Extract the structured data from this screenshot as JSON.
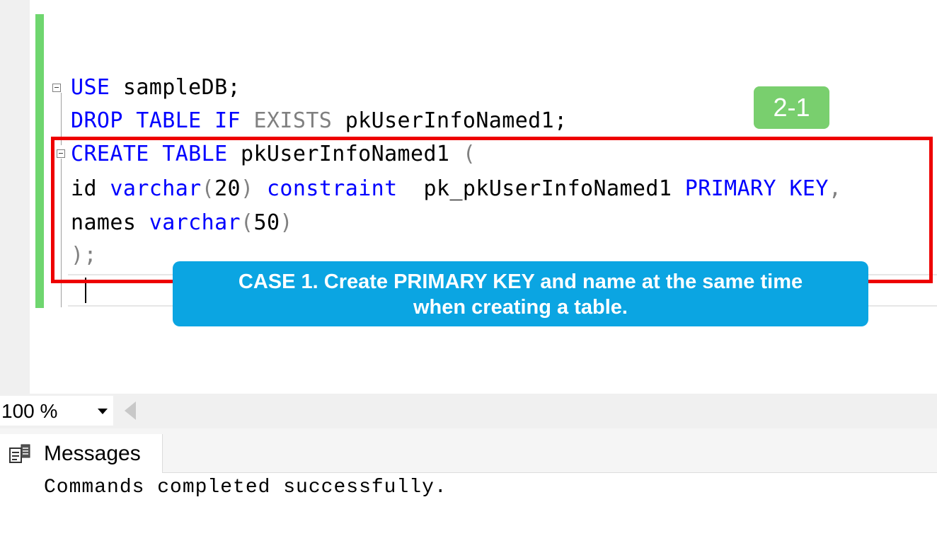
{
  "editor": {
    "code_lines": [
      [
        {
          "text": "USE",
          "cls": "kw"
        },
        {
          "text": " sampleDB;",
          "cls": ""
        }
      ],
      [
        {
          "text": "DROP TABLE IF",
          "cls": "kw"
        },
        {
          "text": " ",
          "cls": ""
        },
        {
          "text": "EXISTS",
          "cls": "kw-gray"
        },
        {
          "text": " pkUserInfoNamed1;",
          "cls": ""
        }
      ],
      [
        {
          "text": "CREATE TABLE",
          "cls": "kw"
        },
        {
          "text": " pkUserInfoNamed1 ",
          "cls": ""
        },
        {
          "text": "(",
          "cls": "kw-gray"
        }
      ],
      [
        {
          "text": "id ",
          "cls": ""
        },
        {
          "text": "varchar",
          "cls": "kw"
        },
        {
          "text": "(",
          "cls": "kw-gray"
        },
        {
          "text": "20",
          "cls": ""
        },
        {
          "text": ")",
          "cls": "kw-gray"
        },
        {
          "text": " ",
          "cls": ""
        },
        {
          "text": "constraint",
          "cls": "kw"
        },
        {
          "text": "  pk_pkUserInfoNamed1 ",
          "cls": ""
        },
        {
          "text": "PRIMARY KEY",
          "cls": "kw"
        },
        {
          "text": ",",
          "cls": "kw-gray"
        }
      ],
      [
        {
          "text": "names ",
          "cls": ""
        },
        {
          "text": "varchar",
          "cls": "kw"
        },
        {
          "text": "(",
          "cls": "kw-gray"
        },
        {
          "text": "50",
          "cls": ""
        },
        {
          "text": ")",
          "cls": "kw-gray"
        }
      ],
      [
        {
          "text": ");",
          "cls": "kw-gray"
        }
      ]
    ]
  },
  "annotation": {
    "step_badge": "2-1",
    "callout_line1": "CASE 1. Create PRIMARY KEY and name at the same time",
    "callout_line2": "when creating a table.",
    "highlight_color": "#ee0000",
    "callout_color": "#0ba5e2",
    "badge_color": "#79cf6e"
  },
  "zoom": {
    "value": "100 %"
  },
  "results": {
    "tab_label": "Messages",
    "tab_icon": "messages-icon",
    "message": "Commands completed successfully."
  },
  "colors": {
    "keyword": "#0000ff",
    "operator": "#808080",
    "change_bar": "#6fd66f"
  }
}
